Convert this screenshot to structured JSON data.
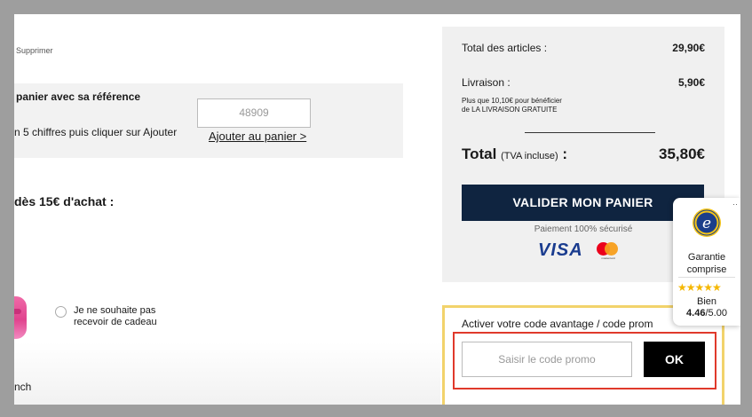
{
  "cart": {
    "delete_label": "Supprimer"
  },
  "reference": {
    "title": "panier avec sa référence",
    "hint": "n 5 chiffres puis cliquer sur Ajouter",
    "input_value": "48909",
    "add_link": "Ajouter au panier >"
  },
  "gift": {
    "title": "dès 15€ d'achat :",
    "no_gift_label": "Je ne souhaite pas recevoir de cadeau",
    "lunch_label": "nch"
  },
  "summary": {
    "articles_label": "Total des articles :",
    "articles_value": "29,90€",
    "shipping_label": "Livraison :",
    "shipping_value": "5,90€",
    "shipping_note_1": "Plus que 10,10€ pour bénéficier",
    "shipping_note_2": "de LA LIVRAISON GRATUITE",
    "total_label": "Total",
    "total_tva": "(TVA incluse)",
    "total_colon": ":",
    "total_value": "35,80€",
    "validate_label": "VALIDER MON PANIER",
    "secure_label": "Paiement 100% sécurisé",
    "visa_label": "VISA",
    "mastercard_label": "mastercard"
  },
  "promo": {
    "title": "Activer votre code avantage / code prom",
    "placeholder": "Saisir le code promo",
    "ok_label": "OK"
  },
  "trust_badge": {
    "dots": "··",
    "line1": "Garantie",
    "line2": "comprise",
    "stars": "★★★★★",
    "rating_word": "Bien",
    "score": "4.46",
    "score_max": "/5.00"
  },
  "colors": {
    "navy": "#0f2440",
    "promo_border": "#f2d36b",
    "highlight_red": "#e0392b",
    "star": "#f5b700"
  }
}
